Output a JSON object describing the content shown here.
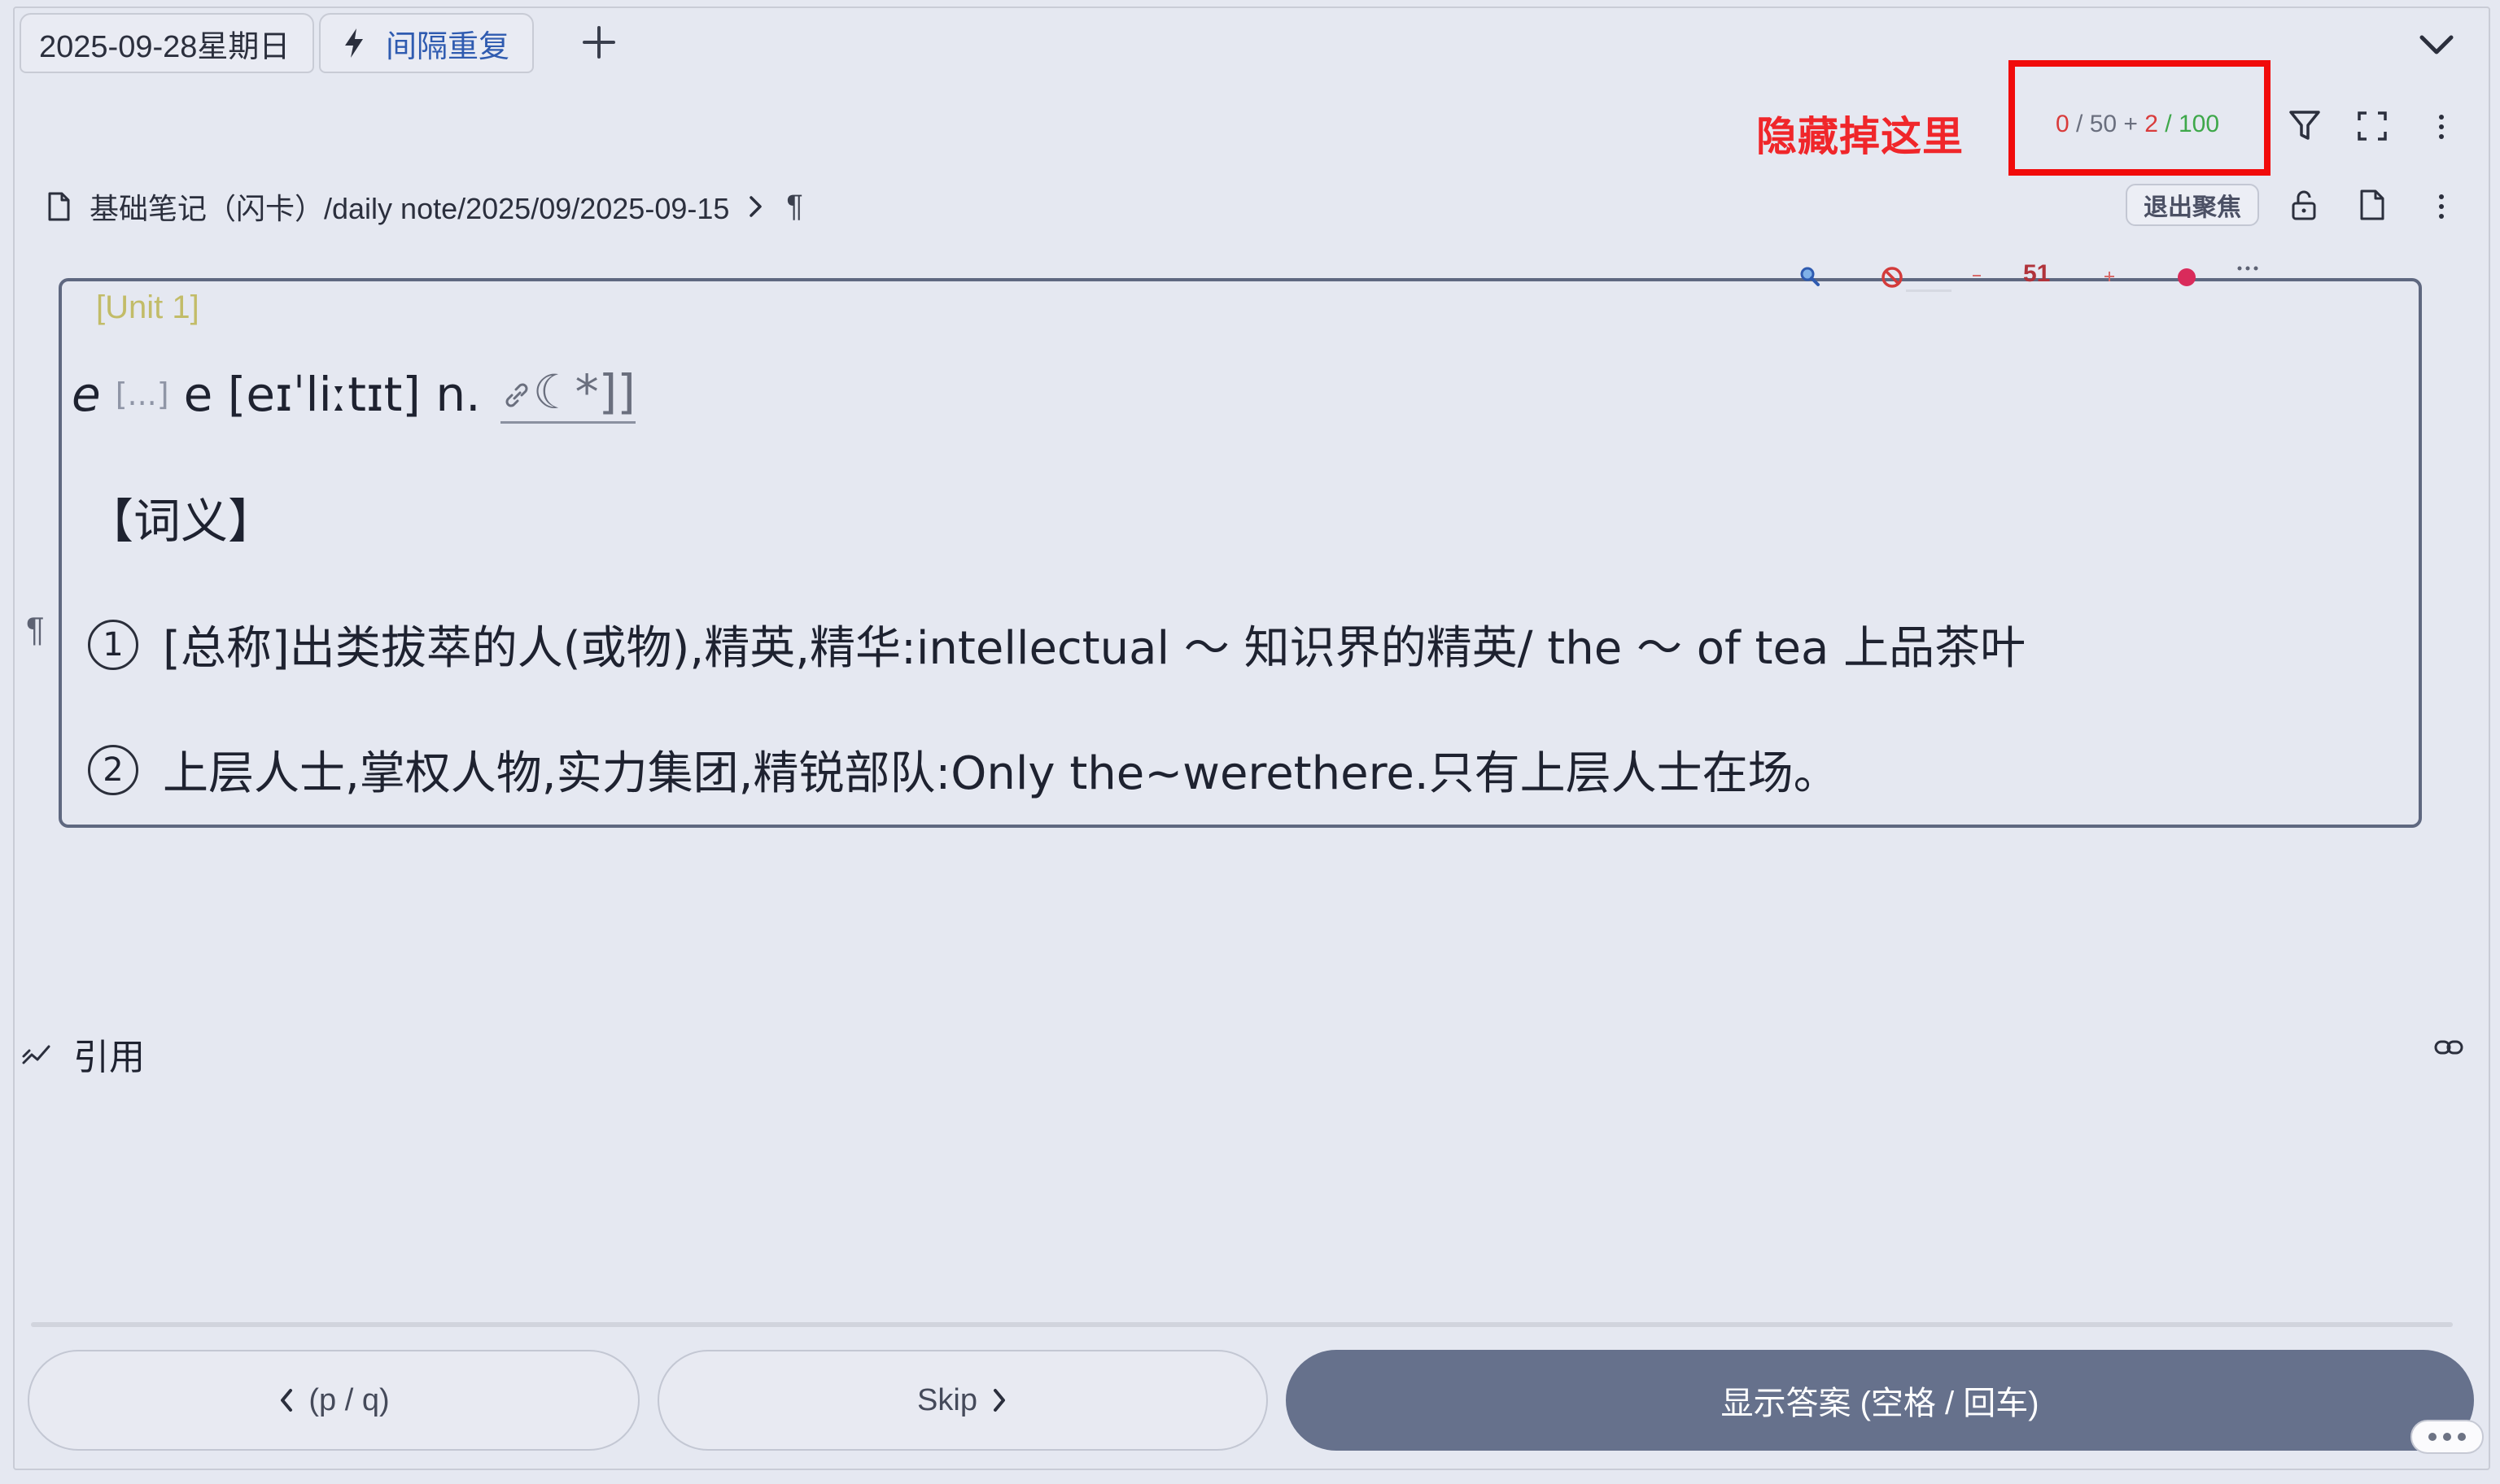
{
  "tabs": {
    "date_tab": "2025-09-28星期日",
    "review_tab": "间隔重复"
  },
  "annotation": {
    "note": "隐藏掉这里"
  },
  "counter": {
    "new_done": "0",
    "new_sep": " / ",
    "new_total": "50",
    "plus": " + ",
    "review_done": "2",
    "review_sep": " / ",
    "review_total": "100"
  },
  "breadcrumb": {
    "path": "基础笔记（闪卡）/daily note/2025/09/2025-09-15",
    "pilcrow": "¶"
  },
  "toolbar": {
    "exit_focus": "退出聚焦"
  },
  "card": {
    "unit_tag": "[Unit 1]",
    "mini_count": "51",
    "word_prefix": "e",
    "cloze": "[...]",
    "word_suffix": "e [eɪˈliːtɪt] n.",
    "link_suffix": "☾*]]",
    "section_title": "【词义】",
    "definitions": [
      {
        "num": "1",
        "text": "[总称]出类拔萃的人(或物),精英,精华:intellectual ～ 知识界的精英/ the ～ of tea 上品茶叶"
      },
      {
        "num": "2",
        "text": "上层人士,掌权人物,实力集团,精锐部队:Only the~werethere.只有上层人士在场。"
      }
    ]
  },
  "references": {
    "label": "引用"
  },
  "buttons": {
    "prev": "(p / q)",
    "skip": "Skip",
    "show_answer": "显示答案 (空格 / 回车)"
  },
  "colors": {
    "annotation_red": "#f10b0b",
    "new_count": "#d93b3b",
    "review_count": "#3ea84a",
    "primary_button": "#66718c",
    "tab_accent": "#2f5bb0"
  }
}
